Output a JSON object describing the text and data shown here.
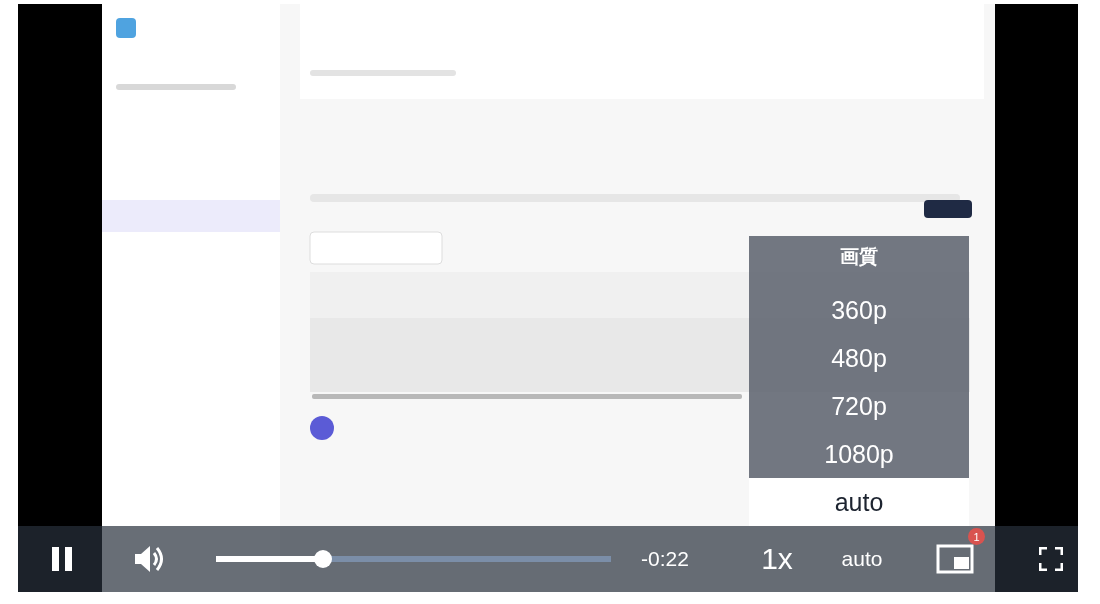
{
  "player": {
    "quality_menu": {
      "title": "画質",
      "options": [
        {
          "label": "360p",
          "selected": false
        },
        {
          "label": "480p",
          "selected": false
        },
        {
          "label": "720p",
          "selected": false
        },
        {
          "label": "1080p",
          "selected": false
        },
        {
          "label": "auto",
          "selected": true
        }
      ]
    },
    "controls": {
      "playing": true,
      "muted": false,
      "progress": {
        "level": 0.27
      },
      "time": "-0:22",
      "speed": "1x",
      "quality": "auto",
      "notification_badge": "1"
    }
  }
}
